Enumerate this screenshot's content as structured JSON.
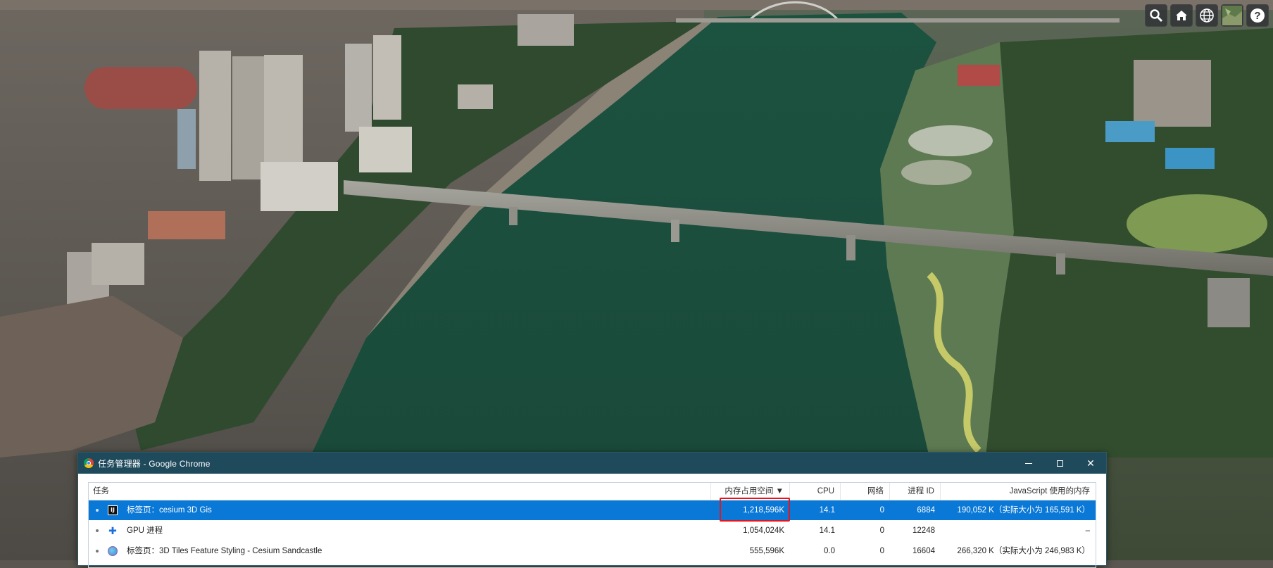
{
  "toolbar": {
    "buttons": [
      {
        "icon": "search-icon"
      },
      {
        "icon": "home-icon"
      },
      {
        "icon": "globe-icon"
      },
      {
        "icon": "base-layer-picker-icon"
      },
      {
        "icon": "help-icon"
      }
    ]
  },
  "task_manager": {
    "title": "任务管理器 - Google Chrome",
    "columns": {
      "task": "任务",
      "memory": "内存占用空间 ▼",
      "cpu": "CPU",
      "network": "网络",
      "pid": "进程 ID",
      "js_memory": "JavaScript 使用的内存"
    },
    "rows": [
      {
        "icon": "intellij-icon",
        "name": "标签页：cesium 3D Gis",
        "memory": "1,218,596K",
        "cpu": "14.1",
        "network": "0",
        "pid": "6884",
        "js_memory": "190,052 K（实际大小为 165,591 K）"
      },
      {
        "icon": "puzzle-icon",
        "name": "GPU 进程",
        "memory": "1,054,024K",
        "cpu": "14.1",
        "network": "0",
        "pid": "12248",
        "js_memory": "–"
      },
      {
        "icon": "cesium-globe-icon",
        "name": "标签页：3D Tiles Feature Styling - Cesium Sandcastle",
        "memory": "555,596K",
        "cpu": "0.0",
        "network": "0",
        "pid": "16604",
        "js_memory": "266,320 K（实际大小为 246,983 K）"
      }
    ]
  },
  "colors": {
    "river": "#1b4d3c",
    "titlebar": "#1f4a5c",
    "selection": "#0a78d7",
    "highlight": "#e8141c"
  }
}
